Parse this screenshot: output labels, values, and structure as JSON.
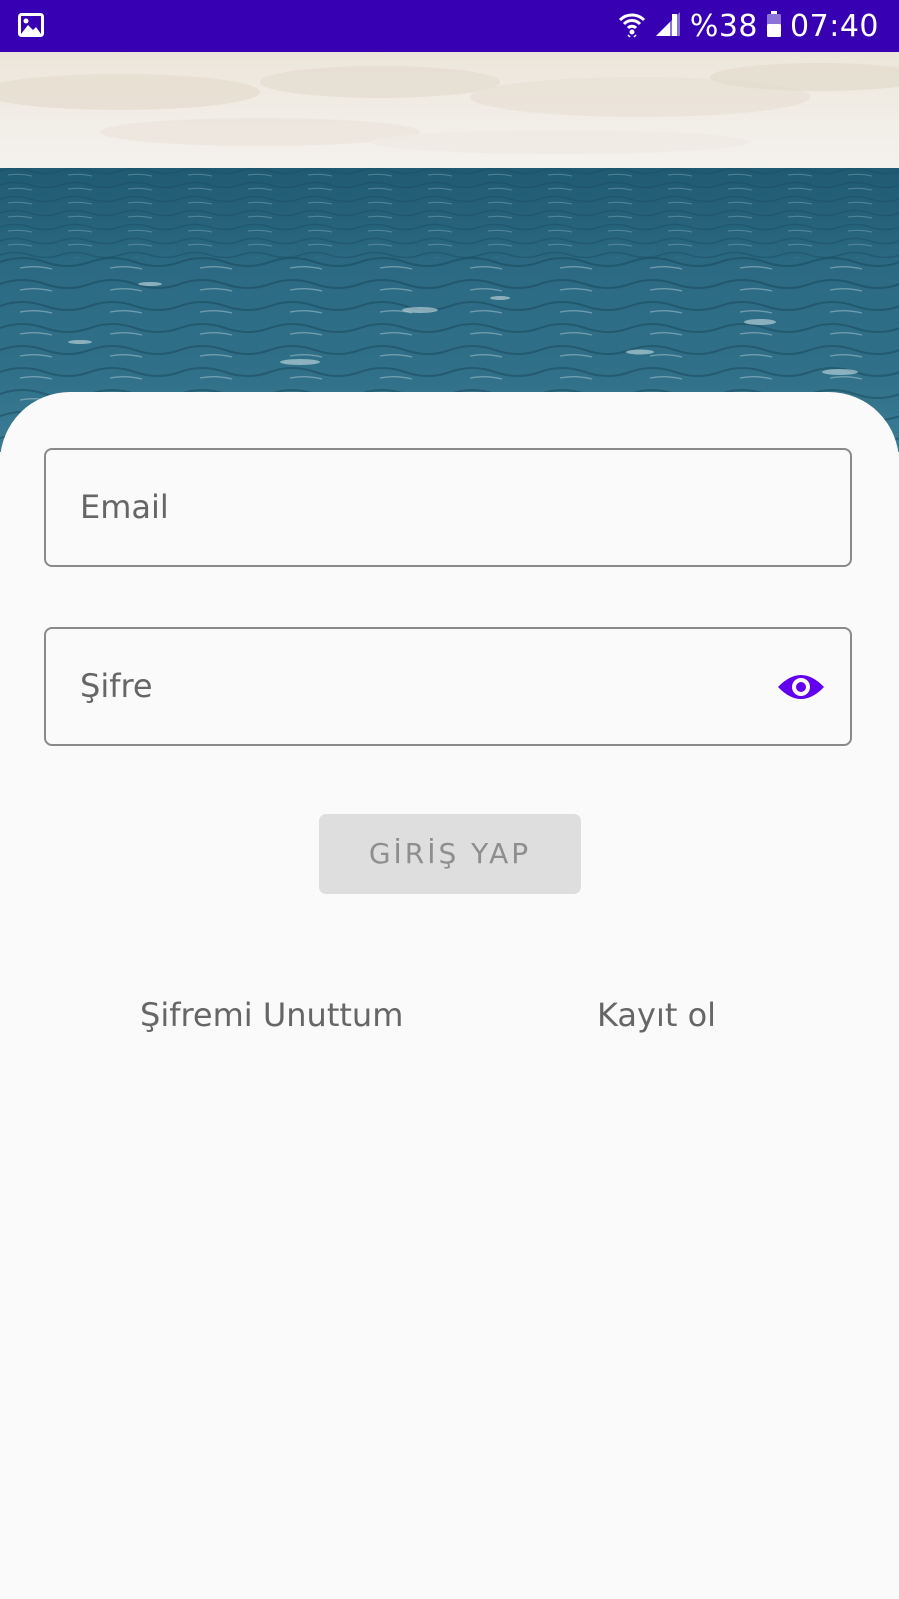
{
  "status_bar": {
    "left_icon": "image-icon",
    "wifi_icon": "wifi-icon",
    "signal_icon": "cellular-signal-icon",
    "battery_text": "%38",
    "battery_icon": "battery-icon",
    "time": "07:40",
    "background_color": "#3700b3"
  },
  "hero": {
    "image": "sea-horizon-photo"
  },
  "login_form": {
    "email_placeholder": "Email",
    "password_placeholder": "Şifre",
    "password_toggle_icon": "eye-icon",
    "accent_color": "#6200ee",
    "login_button_label": "GİRİŞ YAP",
    "forgot_password_label": "Şifremi Unuttum",
    "register_label": "Kayıt ol"
  }
}
